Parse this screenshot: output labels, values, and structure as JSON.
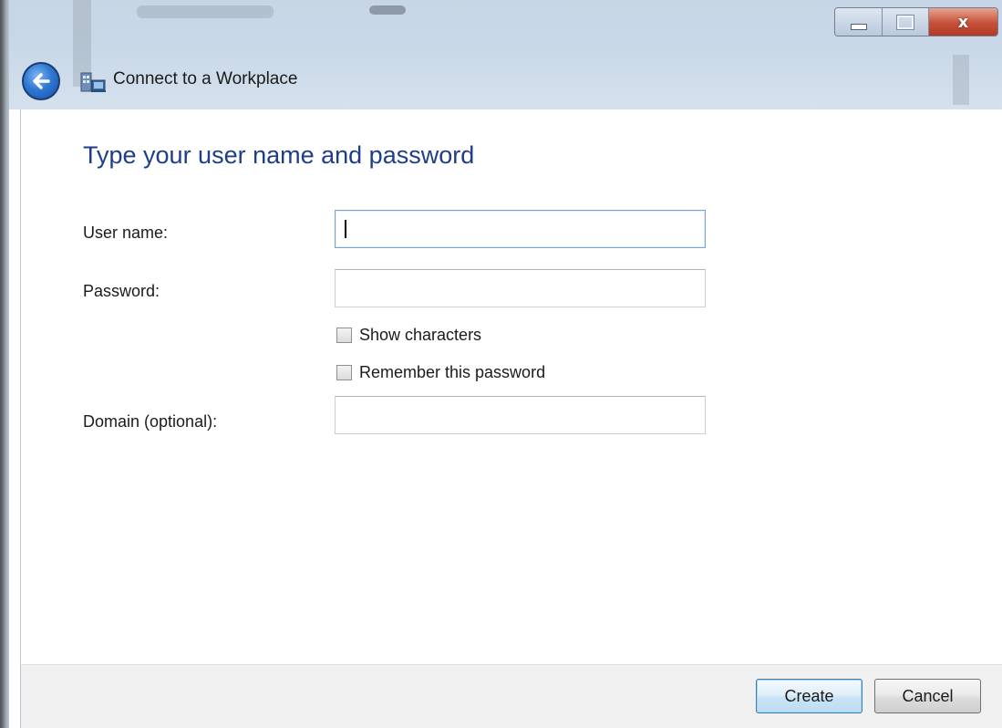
{
  "window": {
    "title": "Connect to a Workplace",
    "caption_close_glyph": "x"
  },
  "heading": "Type your user name and password",
  "form": {
    "username_label": "User name:",
    "username_value": "",
    "password_label": "Password:",
    "password_value": "",
    "show_characters_label": "Show characters",
    "show_characters_checked": false,
    "remember_password_label": "Remember this password",
    "remember_password_checked": false,
    "domain_label": "Domain (optional):",
    "domain_value": ""
  },
  "footer": {
    "create_label": "Create",
    "cancel_label": "Cancel"
  },
  "colors": {
    "heading": "#1e3d8a",
    "close_button": "#c5503a",
    "back_button": "#2f79d3"
  },
  "icons": {
    "back": "back-arrow-icon",
    "app": "workplace-network-icon"
  }
}
